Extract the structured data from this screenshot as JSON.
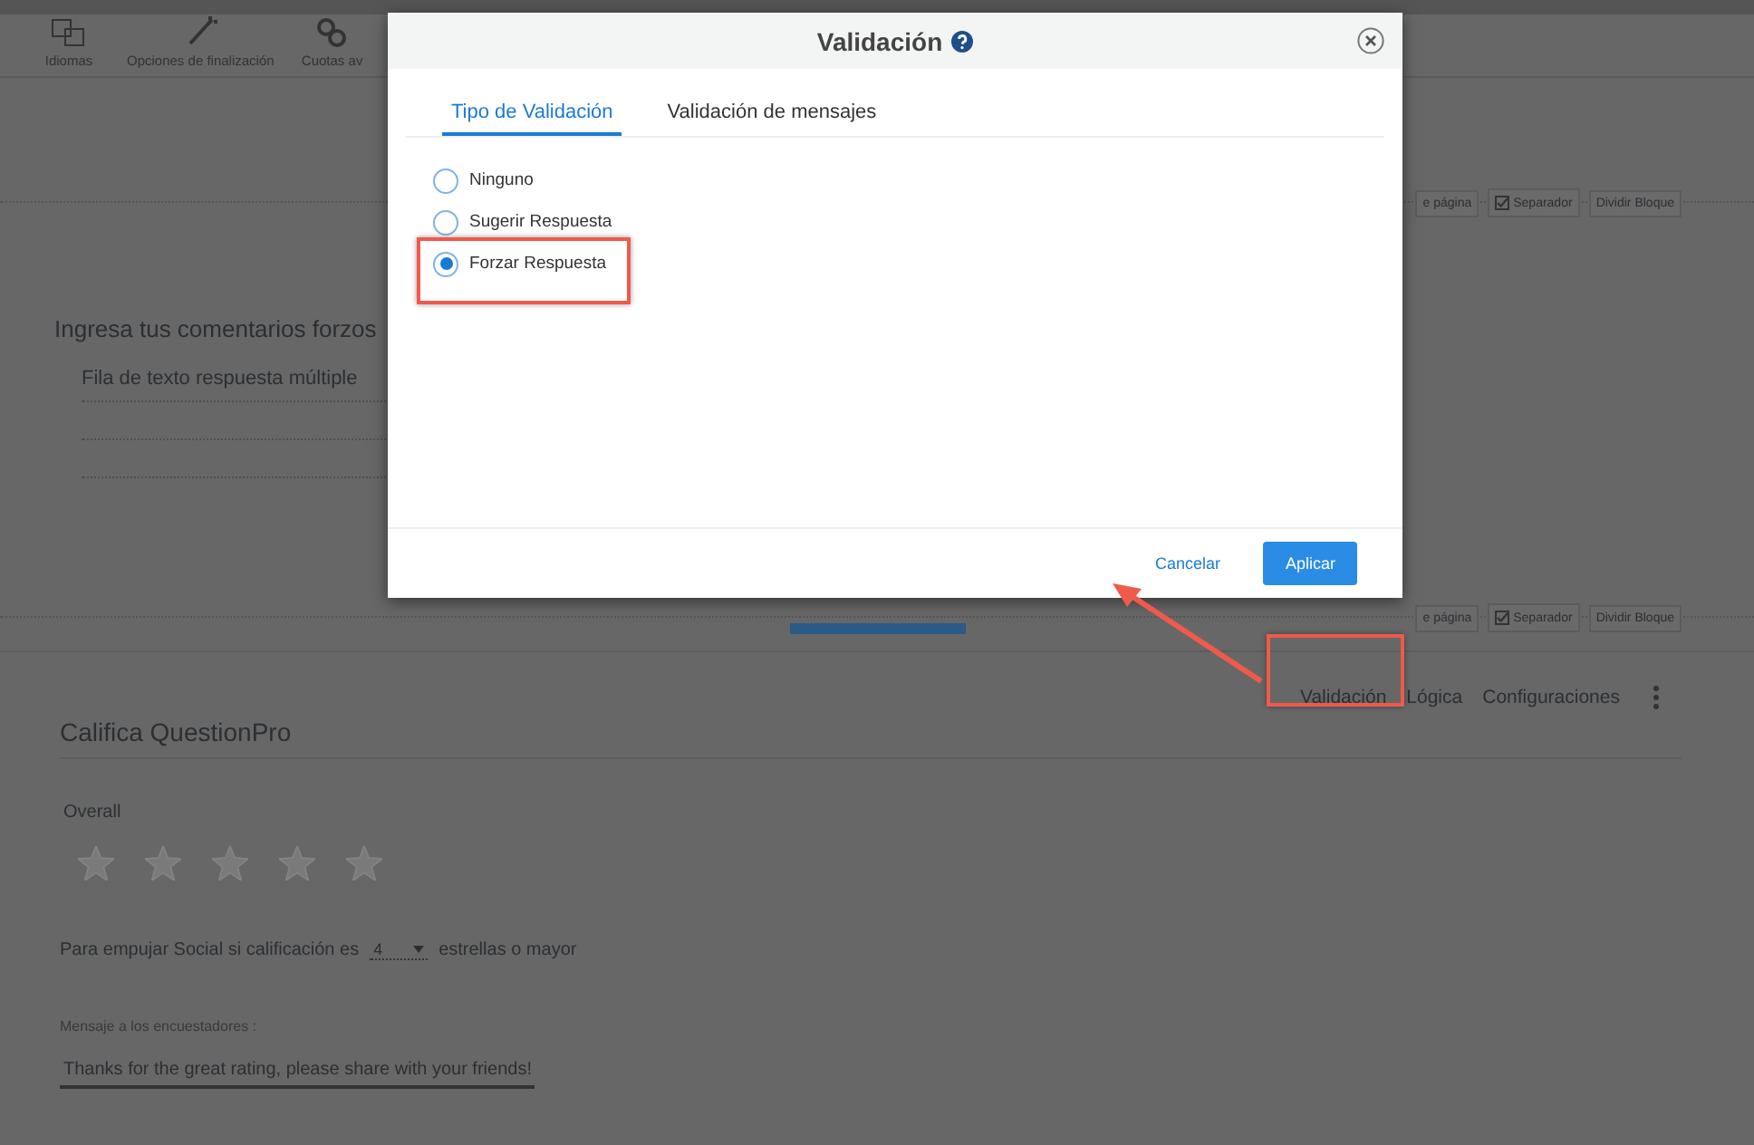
{
  "toolbar": {
    "items": [
      {
        "label": "Idiomas"
      },
      {
        "label": "Opciones de finalización"
      },
      {
        "label": "Cuotas av"
      }
    ]
  },
  "block_bars": [
    {
      "buttons": [
        {
          "kind": "plain",
          "label": "e página"
        },
        {
          "kind": "check",
          "label": "Separador",
          "checked": true
        },
        {
          "kind": "plain",
          "label": "Dividir Bloque"
        }
      ]
    },
    {
      "buttons": [
        {
          "kind": "plain",
          "label": "e página"
        },
        {
          "kind": "check",
          "label": "Separador",
          "checked": true
        },
        {
          "kind": "plain",
          "label": "Dividir Bloque"
        }
      ]
    }
  ],
  "question_1": {
    "title": "Ingresa tus comentarios forzos",
    "rows": [
      "Fila de texto respuesta múltiple"
    ]
  },
  "question_2": {
    "actions": [
      "Validación",
      "Lógica",
      "Configuraciones"
    ],
    "title": "Califica QuestionPro",
    "label": "Overall",
    "stars": 0,
    "rule": {
      "prefix": "Para empujar Social si calificación es",
      "value": "4",
      "suffix": "estrellas o mayor"
    },
    "message_label": "Mensaje a los encuestadores :",
    "message": "Thanks for the great rating, please share with your friends!"
  },
  "modal": {
    "title": "Validación",
    "tabs": [
      {
        "label": "Tipo de Validación",
        "selected": true
      },
      {
        "label": "Validación de mensajes",
        "selected": false
      }
    ],
    "options": [
      {
        "label": "Ninguno",
        "selected": false
      },
      {
        "label": "Sugerir Respuesta",
        "selected": false
      },
      {
        "label": "Forzar Respuesta",
        "selected": true
      }
    ],
    "cancel": "Cancelar",
    "apply": "Aplicar"
  }
}
